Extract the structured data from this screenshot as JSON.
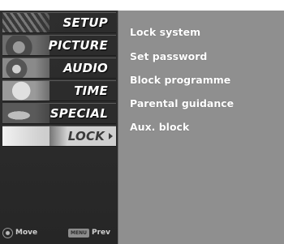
{
  "sidebar": {
    "items": [
      {
        "label": "SETUP",
        "icon": "setup-thumbnail-icon"
      },
      {
        "label": "PICTURE",
        "icon": "picture-thumbnail-icon"
      },
      {
        "label": "AUDIO",
        "icon": "audio-thumbnail-icon"
      },
      {
        "label": "TIME",
        "icon": "time-thumbnail-icon"
      },
      {
        "label": "SPECIAL",
        "icon": "special-thumbnail-icon"
      },
      {
        "label": "LOCK",
        "icon": "lock-thumbnail-icon",
        "selected": true
      }
    ]
  },
  "lock_menu": {
    "options": [
      "Lock system",
      "Set password",
      "Block programme",
      "Parental guidance",
      "Aux. block"
    ]
  },
  "footer": {
    "move_label": "Move",
    "menu_key_label": "MENU",
    "prev_label": "Prev"
  },
  "colors": {
    "sidebar_bg": "#2e2e2e",
    "content_bg": "#8f8f8f",
    "text": "#ffffff",
    "selected_bg": "#d2d2d2"
  }
}
